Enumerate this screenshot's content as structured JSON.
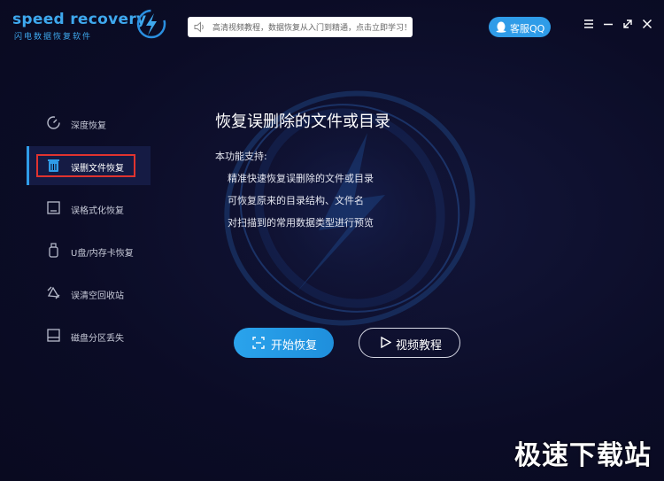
{
  "header": {
    "logo_text": "speed recovery",
    "logo_sub": "闪电数据恢复软件",
    "search_placeholder": "高清视频教程，数据恢复从入门到精通，点击立即学习！",
    "qq_label": "客服QQ",
    "window_controls": [
      "menu-icon",
      "minimize-icon",
      "restore-icon",
      "close-icon"
    ]
  },
  "sidebar": {
    "items": [
      {
        "label": "深度恢复",
        "icon": "deep-scan-icon"
      },
      {
        "label": "误删文件恢复",
        "icon": "trash-icon",
        "active": true
      },
      {
        "label": "误格式化恢复",
        "icon": "format-disk-icon"
      },
      {
        "label": "U盘/内存卡恢复",
        "icon": "usb-icon"
      },
      {
        "label": "误清空回收站",
        "icon": "recycle-icon"
      },
      {
        "label": "磁盘分区丢失",
        "icon": "partition-icon"
      }
    ]
  },
  "main": {
    "title": "恢复误删除的文件或目录",
    "intro": "本功能支持:",
    "features": [
      "精准快速恢复误删除的文件或目录",
      "可恢复原来的目录结构、文件名",
      "对扫描到的常用数据类型进行预览"
    ],
    "start_label": "开始恢复",
    "video_label": "视频教程"
  },
  "watermark": "极速下载站",
  "colors": {
    "background": "#0b0c26",
    "accent": "#2f9ce8",
    "highlight_box": "#e0332f"
  }
}
